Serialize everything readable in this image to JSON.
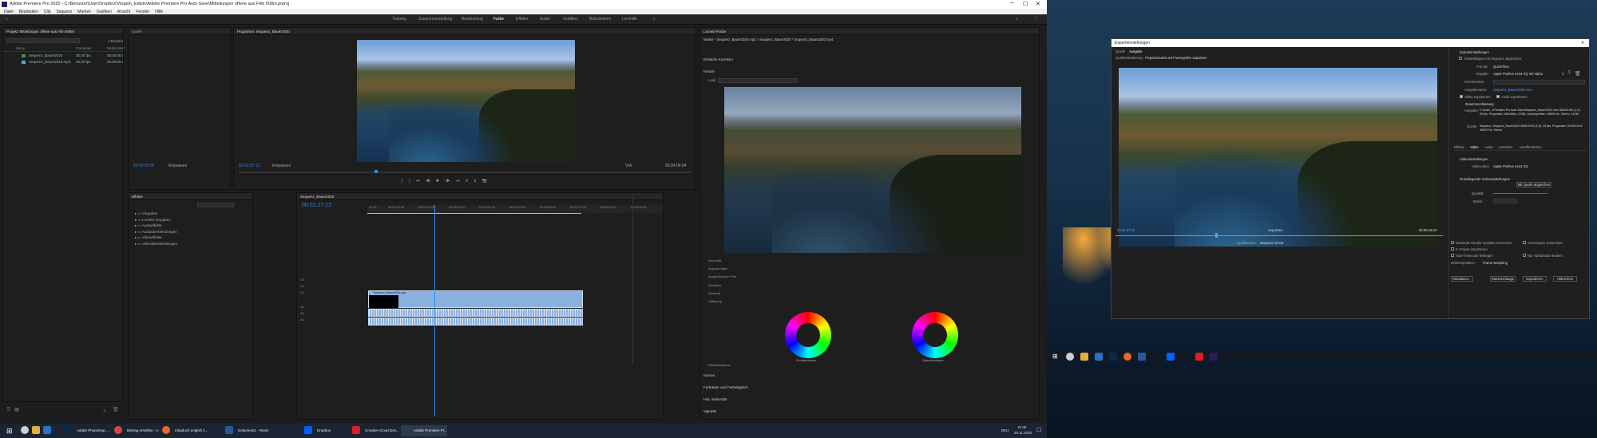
{
  "window": {
    "title": "Adobe Premiere Pro 2020 - C:\\Benutzer\\User\\Dropbox\\Vlogeln_Edwin\\Adobe Premiere Pro Auto-Save\\Mitteilungen offene aus Film 508m.prproj",
    "menu": [
      "Datei",
      "Bearbeiten",
      "Clip",
      "Sequenz",
      "Marken",
      "Grafiken",
      "Ansicht",
      "Fenster",
      "Hilfe"
    ]
  },
  "workspaces": [
    "Training",
    "Zusammenstellung",
    "Bearbeitung",
    "Farbe",
    "Effekte",
    "Audio",
    "Grafiken",
    "Bibliotheken",
    "Lernhilfe"
  ],
  "active_workspace": "Farbe",
  "project": {
    "tab": "Projekt: Mitteilungen offene aus Film 508m",
    "search_label": "1 Element",
    "columns": [
      "Name",
      "Framerate",
      "Medienstart"
    ],
    "items": [
      {
        "name": "Sequenz_Bauer2020",
        "rate": "25,00 fps",
        "start": "00:00:00:00"
      },
      {
        "name": "Sequenz_Bauer2020.mp4",
        "rate": "25,00 fps",
        "start": "00:00:00:00"
      }
    ]
  },
  "source_monitor": {
    "timecode": "00:00:00:00",
    "fit": "Einpassen"
  },
  "program_monitor": {
    "tab": "Programm: Sequenz_Bauer2020",
    "timecode": "00:02:27:12",
    "fit": "Einpassen",
    "duration": "00:04:09:04",
    "quality": "Voll"
  },
  "effects": {
    "tab": "Effekte",
    "folders": [
      "Vorgaben",
      "Lumetri-Vorgaben",
      "Audioeffekte",
      "Audioüberblendungen",
      "Videoeffekte",
      "Videoüberblendungen"
    ]
  },
  "timeline": {
    "tab": "Sequenz_Bauer2020",
    "timecode": "00:02:27:12",
    "ruler": [
      "00:00",
      "00:01:00:00",
      "00:02:00:00",
      "00:03:00:00",
      "00:04:00:00",
      "00:05:00:00",
      "00:06:00:00",
      "00:07:00:00",
      "00:08:00:00",
      "00:09:00:00",
      "00:10:00:00"
    ],
    "tracks_video": [
      "V3",
      "V2",
      "V1"
    ],
    "tracks_audio": [
      "A1",
      "A2",
      "A3"
    ],
    "clip_label": "Sequenz_Bauer2020.mp4"
  },
  "lumetri": {
    "tab": "Lumetri-Farbe",
    "path": "Master * Sequenz_Bauer2020.mp4 > Sequenz_Bauer2020 * Sequenz_Bauer2020.mp4",
    "sections": [
      "Einfache Korrektur",
      "Kreativ",
      "Kurven",
      "Farbräder und Farbabgleich",
      "HSL-Sekundär",
      "Vignette"
    ],
    "look_label": "Look",
    "sliders": [
      "Intensität",
      "Anpassungen",
      "Ausgeblichene Film",
      "Schärfen",
      "Dynamik",
      "Sättigung"
    ],
    "wheel1": "Schattenfarbe",
    "wheel2": "Glanzlichtfarbe",
    "tint_balance": "Farbtonbalance"
  },
  "export": {
    "title": "Exporteinstellungen",
    "tabs": [
      "Quelle",
      "Ausgabe"
    ],
    "scaling_label": "Quellenskalierung:",
    "scaling_value": "Proportionales auf Framegröße anpassen",
    "timecode_in": "00:02:27:12",
    "timecode_out": "00:09:16:04",
    "fit_value": "Anpassen",
    "source_range_label": "Quellbereich:",
    "source_range_value": "Sequenz In/Out",
    "settings_header": "Exporteinstellungen",
    "match_sequence": "Einstellungen mit Sequenz abgleichen",
    "format_label": "Format:",
    "format_value": "QuickTime",
    "preset_label": "Vorgabe:",
    "preset_value": "Apple ProRes 4444 XQ mit Alpha",
    "comments_label": "Kommentare:",
    "output_label": "Ausgabename:",
    "output_value": "Sequenz_Bauer2020.mov",
    "export_video": "Video exportieren",
    "export_audio": "Audio exportieren",
    "summary_header": "Zusammenfassung",
    "output_summary_label": "Ausgabe:",
    "output_summary": "C:\\User\\...\\Premiere Pro Auto-Save\\Sequenz_Bauer2020.mov 3840x2160 (1,0), 25 fps, Progressiv, 448 kbit/s, 10-Bit, Unkomprimiert, 48000 Hz, Stereo, 16 Bit",
    "source_summary_label": "Quelle:",
    "source_summary": "Sequenz, Sequenz_Bauer2020 3840x2160 (1,0), 25 fps, Progressiv, 00:09:16:04 48000 Hz, Stereo",
    "bottom_tabs": [
      "Effekte",
      "Video",
      "Audio",
      "Untertitel",
      "Veröffentlichen"
    ],
    "basic_video": "Videoeinstellungen",
    "codec_label": "Videocodec:",
    "codec_value": "Apple ProRes 4444 XQ",
    "basic_settings": "Grundlegende Videoeinstellungen",
    "match_source": "Mit Quelle abgleichen",
    "quality_label": "Qualität:",
    "width_label": "Breite:",
    "max_render": "Maximale Render-Qualität verwenden",
    "use_previews": "Vorschauen verwenden",
    "import_project": "In Projekt importieren",
    "set_start_tc": "Start-Timecode festlegen",
    "alpha_only": "Nur Alphakanal rendern",
    "time_interp_label": "Zeitinterpolation:",
    "time_interp_value": "Frame-Sampling",
    "buttons": {
      "metadata": "Metadaten...",
      "queue": "Warteschlange",
      "export": "Exportieren",
      "cancel": "Abbrechen"
    }
  },
  "taskbar1": {
    "items": [
      "Adobe Photoshop ...",
      "Beitrag erstellen - A...",
      "mbaduch english h...",
      "Dokument1 - Word",
      "Dropbox",
      "Creative Cloud Des...",
      "Adobe Premiere Pr..."
    ],
    "lang": "DEU",
    "time": "10:38",
    "date": "20.11.2020"
  },
  "colors": {
    "accent": "#2d8ceb",
    "clip": "#8ab0e0",
    "playhead": "#2d8ceb",
    "panel": "#1e1e1e"
  }
}
